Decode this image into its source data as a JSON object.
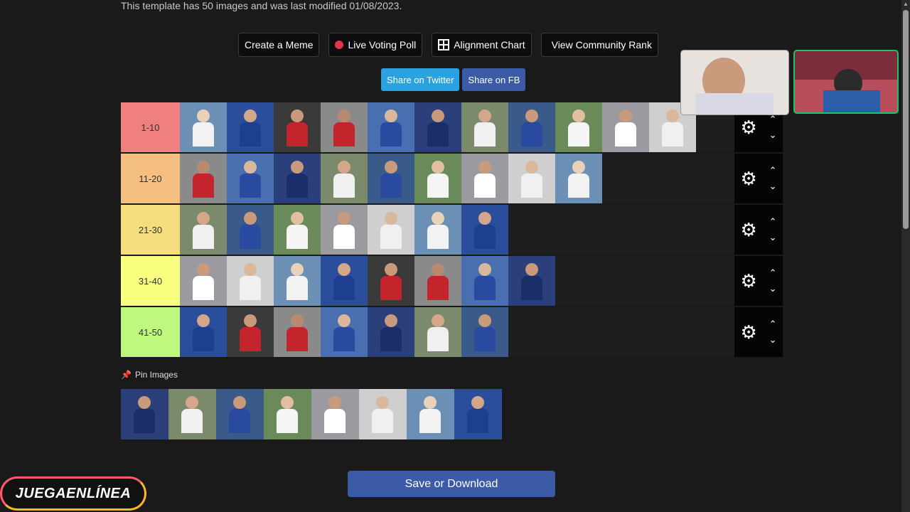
{
  "page": {
    "meta_text": "This template has 50 images and was last modified 01/08/2023."
  },
  "toolbar": {
    "create_meme": "Create a Meme",
    "live_voting": "Live Voting Poll",
    "alignment": "Alignment Chart",
    "community_rank": "View Community Rank"
  },
  "share": {
    "twitter": "Share on Twitter",
    "facebook": "Share on FB",
    "twitter_color": "#2aa2e2",
    "facebook_color": "#3c5ba6"
  },
  "tiers": [
    {
      "label": "1-10",
      "color": "#f07f7f",
      "count": 11
    },
    {
      "label": "11-20",
      "color": "#f5bf80",
      "count": 9
    },
    {
      "label": "21-30",
      "color": "#f6de7f",
      "count": 7
    },
    {
      "label": "31-40",
      "color": "#f9ff7f",
      "count": 8
    },
    {
      "label": "41-50",
      "color": "#bff77f",
      "count": 7
    }
  ],
  "pin": {
    "label": "Pin Images",
    "count": 8
  },
  "save": {
    "label": "Save or Download"
  },
  "logo": {
    "text": "JUEGAENLÍNEA"
  }
}
